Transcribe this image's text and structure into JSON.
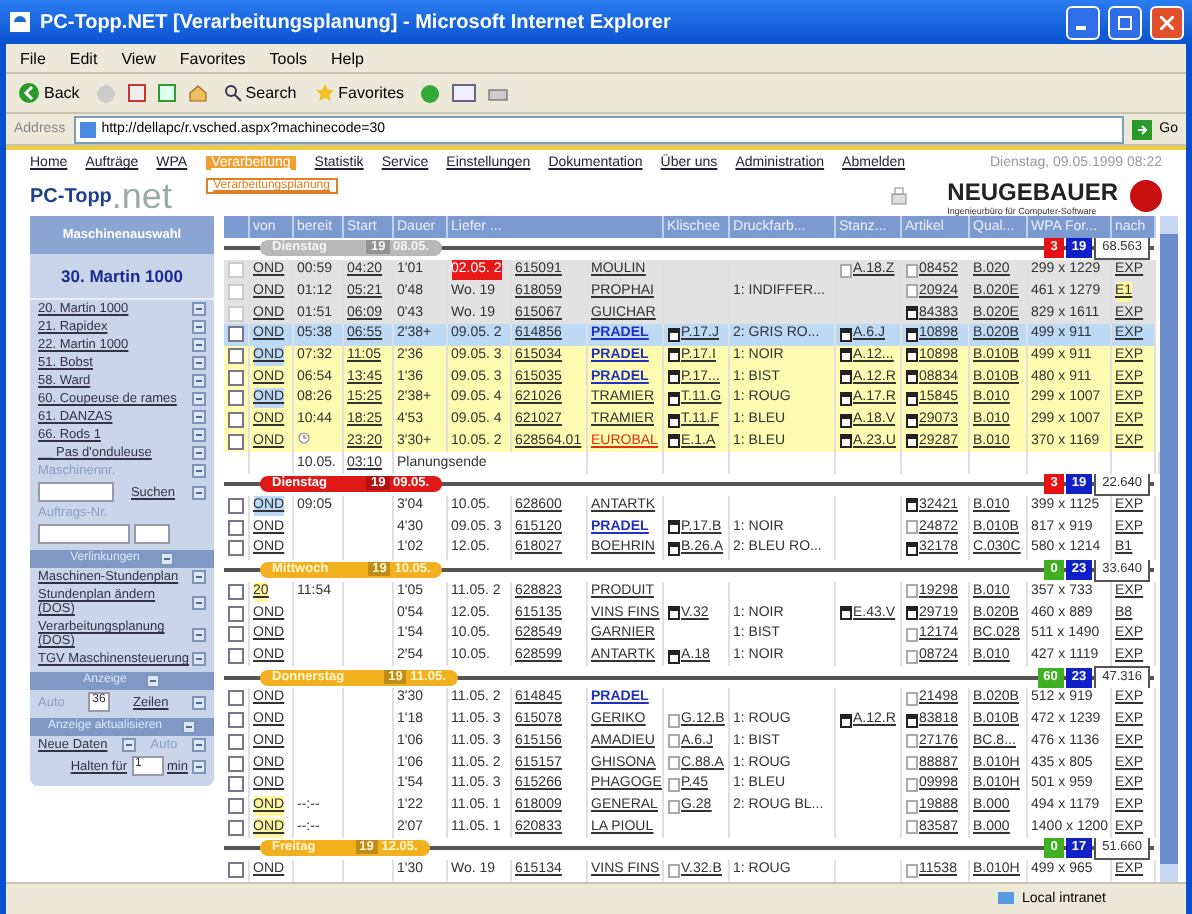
{
  "window": {
    "title": "PC-Topp.NET [Verarbeitungsplanung] - Microsoft Internet Explorer",
    "menu": [
      "File",
      "Edit",
      "View",
      "Favorites",
      "Tools",
      "Help"
    ],
    "toolbar": [
      "Back",
      "Search",
      "Favorites"
    ],
    "address_label": "Address",
    "address": "http://dellapc/r.vsched.aspx?machinecode=30",
    "go": "Go"
  },
  "nav": {
    "items": [
      {
        "label": "Home",
        "selected": false
      },
      {
        "label": "Aufträge",
        "selected": false
      },
      {
        "label": "WPA",
        "selected": false
      },
      {
        "label": "Verarbeitung",
        "selected": true
      },
      {
        "label": "Statistik",
        "selected": false
      },
      {
        "label": "Service",
        "selected": false
      },
      {
        "label": "Einstellungen",
        "selected": false
      },
      {
        "label": "Dokumentation",
        "selected": false
      },
      {
        "label": "Über uns",
        "selected": false
      },
      {
        "label": "Administration",
        "selected": false
      },
      {
        "label": "Abmelden",
        "selected": false
      }
    ],
    "submenu": "Verarbeitungsplanung",
    "date": "Dienstag, 09.05.1999 08:22"
  },
  "logo": {
    "main": "PC-Topp",
    "suffix": ".net",
    "company": "NEUGEBAUER",
    "tagline": "Ingenieurbüro für Computer-Software"
  },
  "sidebar": {
    "title": "Maschinenauswahl",
    "current": "30. Martin 1000",
    "machines": [
      "20. Martin 1000",
      "21. Rapidex",
      "22. Martin 1000",
      "51. Bobst",
      "58. Ward",
      "60. Coupeuse de rames",
      "61. DANZAS",
      "66. Rods 1",
      "__ Pas d'onduleuse"
    ],
    "machine_no_label": "Maschinennr.",
    "search": "Suchen",
    "order_no_label": "Auftrags-Nr.",
    "links_title": "Verlinkungen",
    "links": [
      "Maschinen-Stundenplan",
      "Stundenplan ändern (DOS)",
      "Verarbeitungsplanung (DOS)",
      "TGV Maschinensteuerung"
    ],
    "display_title": "Anzeige",
    "auto": "Auto",
    "rows_value": "36",
    "rows_label": "Zeilen",
    "refresh_title": "Anzeige aktualisieren",
    "new_data": "Neue Daten",
    "auto2": "Auto",
    "hold_label": "Halten für",
    "hold_value": "1",
    "hold_unit": "min"
  },
  "table": {
    "columns": [
      "von",
      "bereit",
      "Start",
      "Dauer",
      "Liefer ...",
      "Klischee",
      "Druckfarb...",
      "Stanz...",
      "Artikel",
      "Qual...",
      "WPA For...",
      "nach"
    ],
    "groups": [
      {
        "day": "Dienstag",
        "week": "19",
        "date": "08.05.",
        "kind": "grey",
        "badges": [
          {
            "value": "3",
            "color": "#e81010"
          },
          {
            "value": "19",
            "color": "#1020c8"
          }
        ],
        "total": "68.563",
        "rows": [
          {
            "kind": "order",
            "disabled": true,
            "color": "#e2e2e2",
            "von": "OND",
            "bereit": "00:59",
            "start": "04:20",
            "dauer": "1'01",
            "liefer": "02.05. 2",
            "liefer_alert": true,
            "auftrag": "615091",
            "kunde": "MOULIN",
            "stanz": "A.18.Z",
            "stanz_doc_filled": false,
            "artikel": "08452",
            "artikel_doc_filled": false,
            "qual": "B.020",
            "format": "299 x 1229",
            "nach": "EXP"
          },
          {
            "kind": "order",
            "disabled": true,
            "color": "#e2e2e2",
            "von": "OND",
            "bereit": "01:12",
            "start": "05:21",
            "dauer": "0'48",
            "liefer": "Wo. 19",
            "auftrag": "618059",
            "kunde": "PROPHAI",
            "druck": "1: INDIFFER...",
            "artikel": "20924",
            "artikel_doc_filled": false,
            "qual": "B.020E",
            "format": "461 x 1279",
            "nach": "E1",
            "nach_mark": true
          },
          {
            "kind": "order",
            "disabled": true,
            "color": "#e2e2e2",
            "von": "OND",
            "bereit": "01:51",
            "start": "06:09",
            "dauer": "0'43",
            "liefer": "Wo. 19",
            "auftrag": "615067",
            "kunde": "GUICHAR",
            "artikel": "84383",
            "artikel_doc_filled": true,
            "qual": "B.020E",
            "format": "829 x 1611",
            "nach": "EXP"
          },
          {
            "kind": "order",
            "disabled": false,
            "color": "#bcd9f6",
            "von": "OND",
            "bereit": "05:38",
            "start": "06:55",
            "dauer": "2'38+",
            "liefer": "09.05. 2",
            "auftrag": "614856",
            "kunde": "PRADEL",
            "kunde_link": true,
            "klischee": "P.17.J",
            "klischee_doc_filled": true,
            "druck": "2: GRIS RO...",
            "stanz": "A.6.J",
            "stanz_doc_filled": true,
            "artikel": "10898",
            "artikel_doc_filled": true,
            "qual": "B.020B",
            "format": "499 x 911",
            "nach": "EXP"
          },
          {
            "kind": "order",
            "disabled": false,
            "color": "#fffbb0",
            "von": "OND",
            "von_mark": {
              "color": "#bcd9f6"
            },
            "bereit": "07:32",
            "start": "11:05",
            "dauer": "2'36",
            "liefer": "09.05. 3",
            "auftrag": "615034",
            "kunde": "PRADEL",
            "kunde_link": true,
            "klischee": "P.17.I",
            "klischee_doc_filled": true,
            "druck": "1: NOIR",
            "stanz": "A.12...",
            "stanz_doc_filled": true,
            "artikel": "10898",
            "artikel_doc_filled": true,
            "qual": "B.010B",
            "format": "499 x 911",
            "nach": "EXP"
          },
          {
            "kind": "order",
            "disabled": false,
            "color": "#fffbb0",
            "von": "OND",
            "bereit": "06:54",
            "start": "13:45",
            "dauer": "1'36",
            "liefer": "09.05. 3",
            "auftrag": "615035",
            "kunde": "PRADEL",
            "kunde_link": true,
            "klischee": "P.17...",
            "klischee_doc_filled": true,
            "druck": "1: BIST",
            "stanz": "A.12.R",
            "stanz_doc_filled": true,
            "artikel": "08834",
            "artikel_doc_filled": true,
            "qual": "B.010B",
            "format": "480 x 911",
            "nach": "EXP"
          },
          {
            "kind": "order",
            "disabled": false,
            "color": "#fffbb0",
            "von": "OND",
            "von_mark": {
              "color": "#bcd9f6"
            },
            "bereit": "08:26",
            "start": "15:25",
            "dauer": "2'38+",
            "liefer": "09.05. 4",
            "auftrag": "621026",
            "kunde": "TRAMIER",
            "klischee": "T.11.G",
            "klischee_doc_filled": true,
            "druck": "1: ROUG",
            "stanz": "A.17.R",
            "stanz_doc_filled": true,
            "artikel": "15845",
            "artikel_doc_filled": true,
            "qual": "B.010",
            "format": "299 x 1007",
            "nach": "EXP"
          },
          {
            "kind": "order",
            "disabled": false,
            "color": "#fffbb0",
            "von": "OND",
            "bereit": "10:44",
            "start": "18:25",
            "dauer": "4'53",
            "liefer": "09.05. 4",
            "auftrag": "621027",
            "kunde": "TRAMIER",
            "klischee": "T.11.F",
            "klischee_doc_filled": true,
            "druck": "1: BLEU",
            "stanz": "A.18.V",
            "stanz_doc_filled": true,
            "artikel": "29073",
            "artikel_doc_filled": true,
            "qual": "B.010",
            "format": "299 x 1007",
            "nach": "EXP"
          },
          {
            "kind": "order",
            "disabled": false,
            "color": "#fffbb0",
            "von": "OND",
            "bereit_clock": true,
            "start": "23:20",
            "dauer": "3'30+",
            "liefer": "10.05. 2",
            "auftrag": "628564.01",
            "kunde": "EUROBAL",
            "kunde_alert": true,
            "klischee": "E.1.A",
            "klischee_doc_filled": true,
            "druck": "1: BLEU",
            "stanz": "A.23.U",
            "stanz_doc_filled": true,
            "artikel": "29287",
            "artikel_doc_filled": true,
            "qual": "B.010",
            "format": "370 x 1169",
            "nach": "EXP"
          },
          {
            "kind": "summary",
            "bereit": "10.05.",
            "start": "03:10",
            "dauer": "Planungsende"
          }
        ]
      },
      {
        "day": "Dienstag",
        "week": "19",
        "date": "09.05.",
        "kind": "red",
        "badges": [
          {
            "value": "3",
            "color": "#e81010"
          },
          {
            "value": "19",
            "color": "#1020c8"
          }
        ],
        "total": "22.640",
        "rows": [
          {
            "kind": "order",
            "disabled": false,
            "von": "OND",
            "von_mark": {
              "color": "#bcd9f6"
            },
            "bereit": "09:05",
            "dauer": "3'04",
            "liefer": "10.05.",
            "auftrag": "628600",
            "kunde": "ANTARTK",
            "artikel": "32421",
            "artikel_doc_filled": true,
            "qual": "B.010",
            "format": "399 x 1125",
            "nach": "EXP"
          },
          {
            "kind": "order",
            "disabled": false,
            "von": "OND",
            "dauer": "4'30",
            "liefer": "09.05. 3",
            "auftrag": "615120",
            "kunde": "PRADEL",
            "kunde_link": true,
            "klischee": "P.17.B",
            "klischee_doc_filled": true,
            "druck": "1: NOIR",
            "artikel": "24872",
            "artikel_doc_filled": false,
            "qual": "B.010B",
            "format": "817 x 919",
            "nach": "EXP"
          },
          {
            "kind": "order",
            "disabled": false,
            "von": "OND",
            "dauer": "1'02",
            "liefer": "12.05.",
            "auftrag": "618027",
            "kunde": "BOEHRIN",
            "klischee": "B.26.A",
            "klischee_doc_filled": true,
            "druck": "2: BLEU RO...",
            "artikel": "32178",
            "artikel_doc_filled": true,
            "qual": "C.030C",
            "format": "580 x 1214",
            "nach": "B1"
          }
        ]
      },
      {
        "day": "Mittwoch",
        "week": "19",
        "date": "10.05.",
        "kind": "orange",
        "badges": [
          {
            "value": "0",
            "color": "#40b020"
          },
          {
            "value": "23",
            "color": "#1020c8"
          }
        ],
        "total": "33.640",
        "rows": [
          {
            "kind": "order",
            "disabled": false,
            "von": "20",
            "von_mark": {
              "color": "#fff7a0"
            },
            "bereit": "11:54",
            "dauer": "1'05",
            "liefer": "11.05. 2",
            "auftrag": "628823",
            "kunde": "PRODUIT",
            "artikel": "19298",
            "artikel_doc_filled": false,
            "qual": "B.010",
            "format": "357 x 733",
            "nach": "EXP"
          },
          {
            "kind": "order",
            "disabled": false,
            "von": "OND",
            "dauer": "0'54",
            "liefer": "12.05.",
            "auftrag": "615135",
            "kunde": "VINS FINS",
            "klischee": "V.32",
            "klischee_doc_filled": true,
            "druck": "1: NOIR",
            "stanz": "E.43.V",
            "stanz_doc_filled": true,
            "artikel": "29719",
            "artikel_doc_filled": true,
            "qual": "B.020B",
            "format": "460 x 889",
            "nach": "B8"
          },
          {
            "kind": "order",
            "disabled": false,
            "von": "OND",
            "dauer": "1'54",
            "liefer": "10.05.",
            "auftrag": "628549",
            "kunde": "GARNIER",
            "druck": "1: BIST",
            "artikel": "12174",
            "artikel_doc_filled": false,
            "qual": "BC.028",
            "format": "511 x 1490",
            "nach": "EXP"
          },
          {
            "kind": "order",
            "disabled": false,
            "von": "OND",
            "dauer": "2'54",
            "liefer": "10.05.",
            "auftrag": "628599",
            "kunde": "ANTARTK",
            "klischee": "A.18",
            "klischee_doc_filled": true,
            "druck": "1: NOIR",
            "artikel": "08724",
            "artikel_doc_filled": false,
            "qual": "B.010",
            "format": "427 x 1119",
            "nach": "EXP"
          }
        ]
      },
      {
        "day": "Donnerstag",
        "week": "19",
        "date": "11.05.",
        "kind": "orange",
        "badges": [
          {
            "value": "60",
            "color": "#40b020"
          },
          {
            "value": "23",
            "color": "#1020c8"
          }
        ],
        "total": "47.316",
        "rows": [
          {
            "kind": "order",
            "disabled": false,
            "von": "OND",
            "dauer": "3'30",
            "liefer": "11.05. 2",
            "auftrag": "614845",
            "kunde": "PRADEL",
            "kunde_link": true,
            "artikel": "21498",
            "artikel_doc_filled": false,
            "qual": "B.020B",
            "format": "512 x 919",
            "nach": "EXP"
          },
          {
            "kind": "order",
            "disabled": false,
            "von": "OND",
            "dauer": "1'18",
            "liefer": "11.05. 3",
            "auftrag": "615078",
            "kunde": "GERIKO",
            "klischee": "G.12.B",
            "klischee_doc_filled": false,
            "druck": "1: ROUG",
            "stanz": "A.12.R",
            "stanz_doc_filled": true,
            "artikel": "83818",
            "artikel_doc_filled": true,
            "qual": "B.010B",
            "format": "472 x 1239",
            "nach": "EXP"
          },
          {
            "kind": "order",
            "disabled": false,
            "von": "OND",
            "dauer": "1'06",
            "liefer": "11.05. 3",
            "auftrag": "615156",
            "kunde": "AMADIEU",
            "klischee": "A.6.J",
            "klischee_doc_filled": false,
            "druck": "1: BIST",
            "artikel": "27176",
            "artikel_doc_filled": false,
            "qual": "BC.8...",
            "format": "476 x 1136",
            "nach": "EXP"
          },
          {
            "kind": "order",
            "disabled": false,
            "von": "OND",
            "dauer": "1'06",
            "liefer": "11.05. 2",
            "auftrag": "615157",
            "kunde": "GHISONA",
            "klischee": "C.88.A",
            "klischee_doc_filled": false,
            "druck": "1: ROUG",
            "artikel": "88887",
            "artikel_doc_filled": false,
            "qual": "B.010H",
            "format": "435 x 805",
            "nach": "EXP"
          },
          {
            "kind": "order",
            "disabled": false,
            "von": "OND",
            "dauer": "1'54",
            "liefer": "11.05. 3",
            "auftrag": "615266",
            "kunde": "PHAGOGE",
            "klischee": "P.45",
            "klischee_doc_filled": false,
            "druck": "1: BLEU",
            "artikel": "09998",
            "artikel_doc_filled": false,
            "qual": "B.010H",
            "format": "501 x 959",
            "nach": "EXP"
          },
          {
            "kind": "order",
            "disabled": false,
            "von": "OND",
            "von_mark": {
              "color": "#fff7a0"
            },
            "bereit": "--:--",
            "dauer": "1'22",
            "liefer": "11.05. 1",
            "auftrag": "618009",
            "kunde": "GENERAL",
            "klischee": "G.28",
            "klischee_doc_filled": false,
            "druck": "2: ROUG BL...",
            "artikel": "19888",
            "artikel_doc_filled": false,
            "qual": "B.000",
            "format": "494 x 1179",
            "nach": "EXP"
          },
          {
            "kind": "order",
            "disabled": false,
            "von": "OND",
            "von_mark": {
              "color": "#fff7a0"
            },
            "bereit": "--:--",
            "dauer": "2'07",
            "liefer": "11.05. 1",
            "auftrag": "620833",
            "kunde": "LA PIOUL",
            "artikel": "83587",
            "artikel_doc_filled": false,
            "qual": "B.000",
            "format": "1400 x 1200",
            "nach": "EXP"
          }
        ]
      },
      {
        "day": "Freitag",
        "week": "19",
        "date": "12.05.",
        "kind": "orange",
        "badges": [
          {
            "value": "0",
            "color": "#40b020"
          },
          {
            "value": "17",
            "color": "#1020c8"
          }
        ],
        "total": "51.660",
        "rows": [
          {
            "kind": "order",
            "disabled": false,
            "von": "OND",
            "dauer": "1'30",
            "liefer": "Wo. 19",
            "auftrag": "615134",
            "kunde": "VINS FINS",
            "klischee": "V.32.B",
            "klischee_doc_filled": false,
            "druck": "1: ROUG",
            "artikel": "11538",
            "artikel_doc_filled": false,
            "qual": "B.010H",
            "format": "499 x 965",
            "nach": "EXP"
          }
        ]
      }
    ]
  },
  "status_bar": {
    "zone": "Local intranet"
  }
}
